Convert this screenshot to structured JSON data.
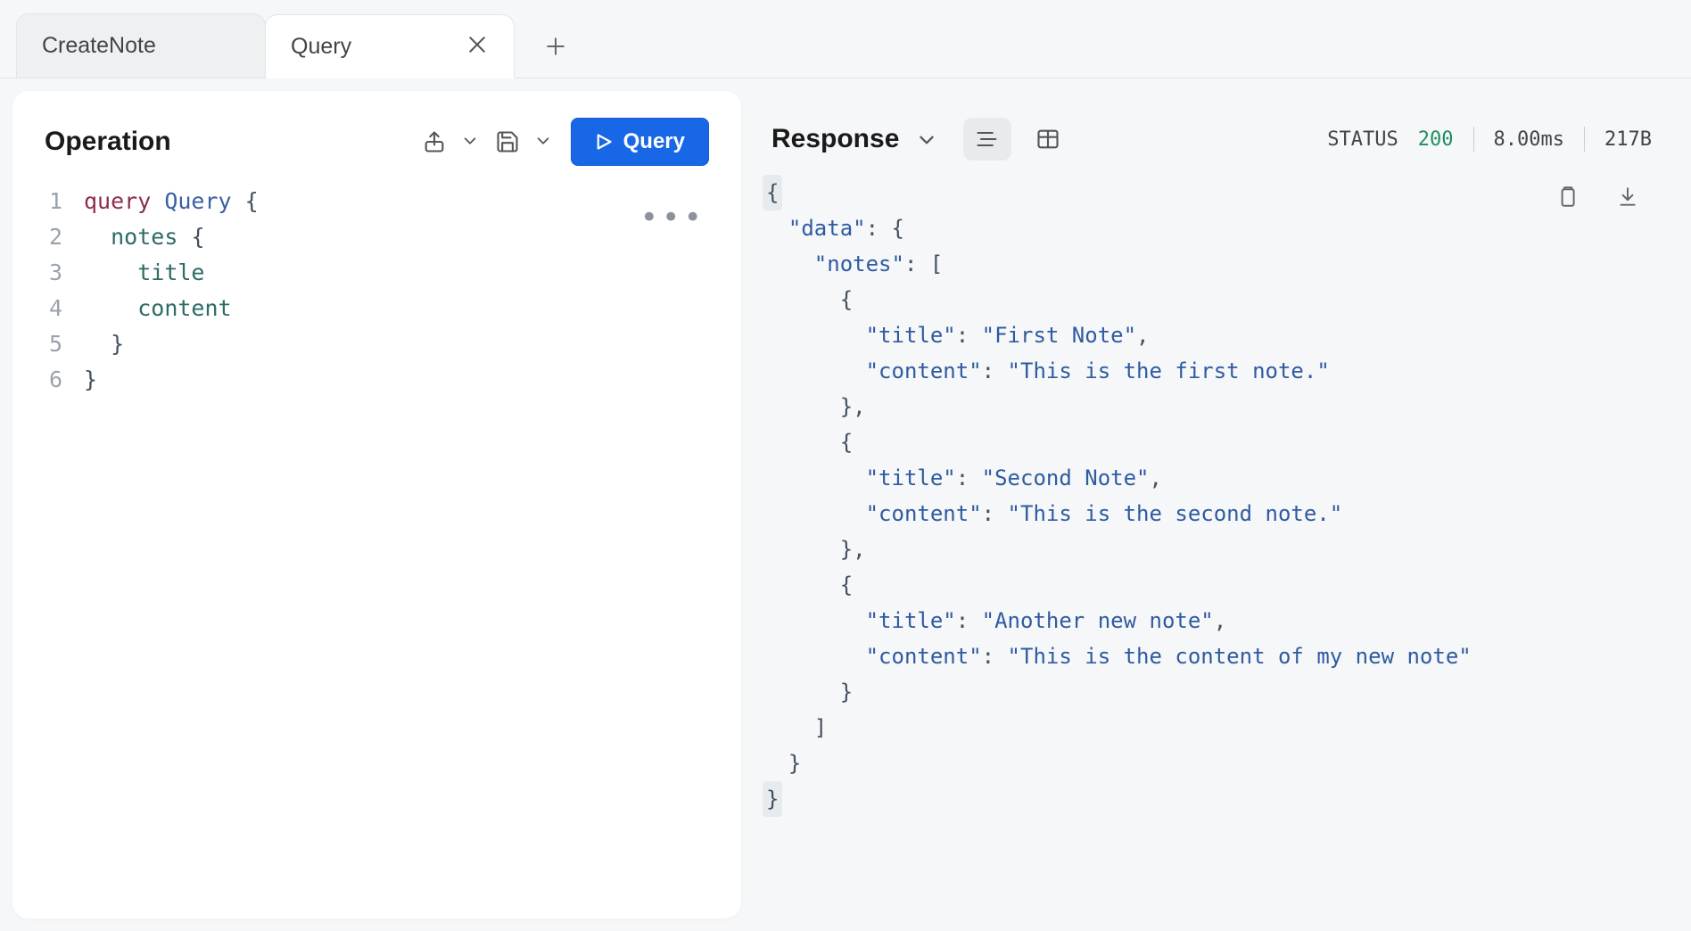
{
  "tabs": [
    {
      "label": "CreateNote",
      "active": false,
      "closable": false
    },
    {
      "label": "Query",
      "active": true,
      "closable": true
    }
  ],
  "operation": {
    "title": "Operation",
    "run_label": "Query",
    "query_lines": [
      {
        "n": "1",
        "tokens": [
          [
            "query",
            "kw-query-decl"
          ],
          [
            " ",
            ""
          ],
          [
            "Query",
            "kw-opname"
          ],
          [
            " ",
            ""
          ],
          [
            "{",
            "brace"
          ]
        ]
      },
      {
        "n": "2",
        "tokens": [
          [
            "  ",
            ""
          ],
          [
            "notes",
            "kw-field"
          ],
          [
            " ",
            ""
          ],
          [
            "{",
            "brace"
          ]
        ]
      },
      {
        "n": "3",
        "tokens": [
          [
            "    ",
            ""
          ],
          [
            "title",
            "kw-field"
          ]
        ]
      },
      {
        "n": "4",
        "tokens": [
          [
            "    ",
            ""
          ],
          [
            "content",
            "kw-field"
          ]
        ]
      },
      {
        "n": "5",
        "tokens": [
          [
            "  ",
            ""
          ],
          [
            "}",
            "brace"
          ]
        ]
      },
      {
        "n": "6",
        "tokens": [
          [
            "}",
            "brace"
          ]
        ]
      }
    ]
  },
  "response_header": {
    "title": "Response",
    "status_label": "STATUS",
    "status_code": "200",
    "time": "8.00ms",
    "size": "217B"
  },
  "response_data": {
    "data": {
      "notes": [
        {
          "title": "First Note",
          "content": "This is the first note."
        },
        {
          "title": "Second Note",
          "content": "This is the second note."
        },
        {
          "title": "Another new note",
          "content": "This is the content of my new note"
        }
      ]
    }
  }
}
